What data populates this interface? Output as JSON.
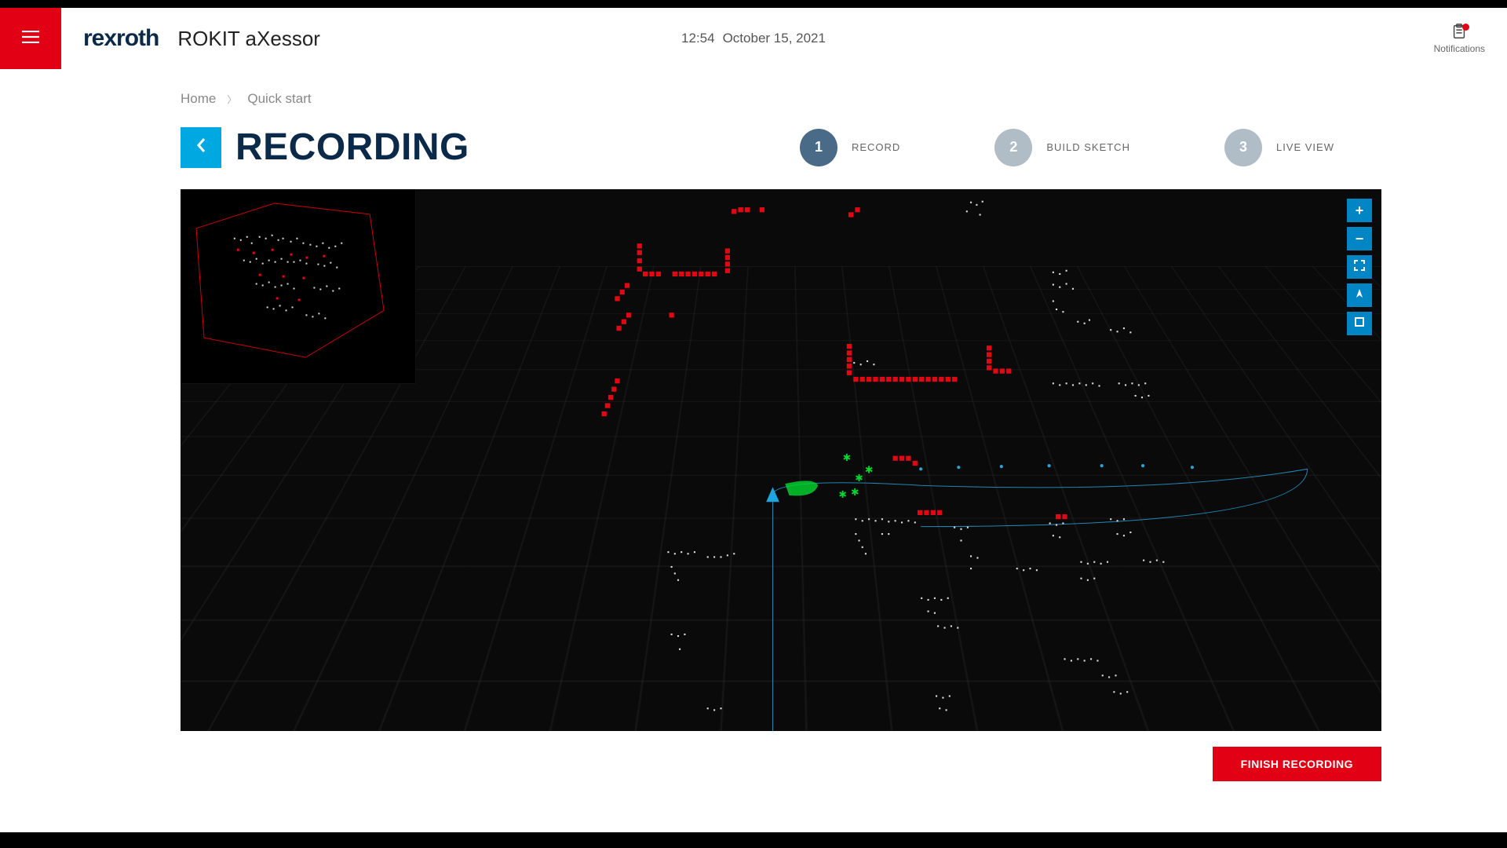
{
  "header": {
    "logo_text": "rexroth",
    "app_name": "ROKIT aXessor",
    "time": "12:54",
    "date": "October 15, 2021",
    "notifications_label": "Notifications"
  },
  "breadcrumb": {
    "home": "Home",
    "current": "Quick start"
  },
  "page": {
    "title": "RECORDING"
  },
  "steps": [
    {
      "num": "1",
      "label": "RECORD",
      "active": true
    },
    {
      "num": "2",
      "label": "BUILD SKETCH",
      "active": false
    },
    {
      "num": "3",
      "label": "LIVE VIEW",
      "active": false
    }
  ],
  "viewer_tools": {
    "zoom_in": "+",
    "zoom_out": "−",
    "fullscreen": "fullscreen-icon",
    "center": "center-icon",
    "reset": "reset-icon"
  },
  "actions": {
    "finish": "FINISH RECORDING"
  },
  "colors": {
    "accent_red": "#e20015",
    "accent_blue": "#00a8e1",
    "tool_blue": "#0086c5",
    "dark_navy": "#0b2a4a"
  }
}
